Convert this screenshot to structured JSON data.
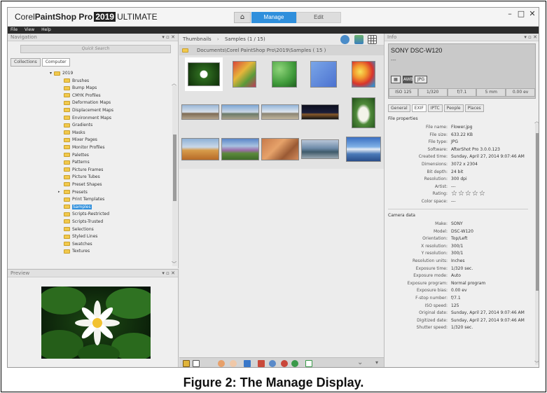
{
  "app": {
    "title_prefix": "Corel",
    "title_brand": "PaintShop Pro",
    "title_year": "2019",
    "title_edition": "ULTIMATE",
    "tabs": {
      "manage": "Manage",
      "edit": "Edit"
    }
  },
  "menu": [
    "File",
    "View",
    "Help"
  ],
  "navigation": {
    "title": "Navigation",
    "search_placeholder": "Quick Search",
    "tabs": [
      "Collections",
      "Computer"
    ],
    "root": "2019",
    "folders": [
      "Brushes",
      "Bump Maps",
      "CMYK Profiles",
      "Deformation Maps",
      "Displacement Maps",
      "Environment Maps",
      "Gradients",
      "Masks",
      "Mixer Pages",
      "Monitor Profiles",
      "Palettes",
      "Patterns",
      "Picture Frames",
      "Picture Tubes",
      "Preset Shapes",
      "Presets",
      "Print Templates",
      "Samples",
      "Scripts-Restricted",
      "Scripts-Trusted",
      "Selections",
      "Styled Lines",
      "Swatches",
      "Textures"
    ],
    "selected": "Samples",
    "expandable": "Presets"
  },
  "preview": {
    "title": "Preview"
  },
  "thumbnails": {
    "title": "Thumbnails",
    "crumb": "Samples  (1 / 15)",
    "path": "Documents\\Corel PaintShop Pro\\2019\\Samples ( 15 )"
  },
  "info": {
    "title": "Info",
    "camera_model": "SONY DSC-W120",
    "camera_dash": "---",
    "badges": [
      "AWB",
      "JPG"
    ],
    "exposure": [
      "ISO 125",
      "1/320",
      "f/7.1",
      "5 mm",
      "0.00 ev"
    ],
    "tabs": [
      "General",
      "EXIF",
      "IPTC",
      "People",
      "Places"
    ],
    "file_properties_title": "File properties",
    "file_properties": [
      {
        "k": "File name:",
        "v": "Flower.jpg"
      },
      {
        "k": "File size:",
        "v": "633.22 KB"
      },
      {
        "k": "File type:",
        "v": "JPG"
      },
      {
        "k": "Software:",
        "v": "AfterShot Pro 3.0.0.123"
      },
      {
        "k": "Created time:",
        "v": "Sunday, April 27, 2014 9:07:46 AM"
      },
      {
        "k": "Dimensions:",
        "v": "3072 x 2304"
      },
      {
        "k": "Bit depth:",
        "v": "24 bit"
      },
      {
        "k": "Resolution:",
        "v": "300 dpi"
      },
      {
        "k": "Artist:",
        "v": "---"
      },
      {
        "k": "Rating:",
        "v": "☆☆☆☆☆"
      },
      {
        "k": "Color space:",
        "v": "---"
      }
    ],
    "camera_data_title": "Camera data",
    "camera_data": [
      {
        "k": "Make:",
        "v": "SONY"
      },
      {
        "k": "Model:",
        "v": "DSC-W120"
      },
      {
        "k": "Orientation:",
        "v": "Top/Left"
      },
      {
        "k": "X resolution:",
        "v": "300/1"
      },
      {
        "k": "Y resolution:",
        "v": "300/1"
      },
      {
        "k": "Resolution units:",
        "v": "Inches"
      },
      {
        "k": "Exposure time:",
        "v": "1/320 sec."
      },
      {
        "k": "Exposure mode:",
        "v": "Auto"
      },
      {
        "k": "Exposure program:",
        "v": "Normal program"
      },
      {
        "k": "Exposure bias:",
        "v": "0.00 ev"
      },
      {
        "k": "F-stop number:",
        "v": "f/7.1"
      },
      {
        "k": "ISO speed:",
        "v": "125"
      },
      {
        "k": "Original date:",
        "v": "Sunday, April 27, 2014 9:07:46 AM"
      },
      {
        "k": "Digitized date:",
        "v": "Sunday, April 27, 2014 9:07:46 AM"
      },
      {
        "k": "Shutter speed:",
        "v": "1/320 sec."
      }
    ]
  },
  "caption": "Figure 2: The Manage Display.",
  "colors": {
    "accent": "#2f8fdc",
    "folder": "#f2c94c"
  }
}
